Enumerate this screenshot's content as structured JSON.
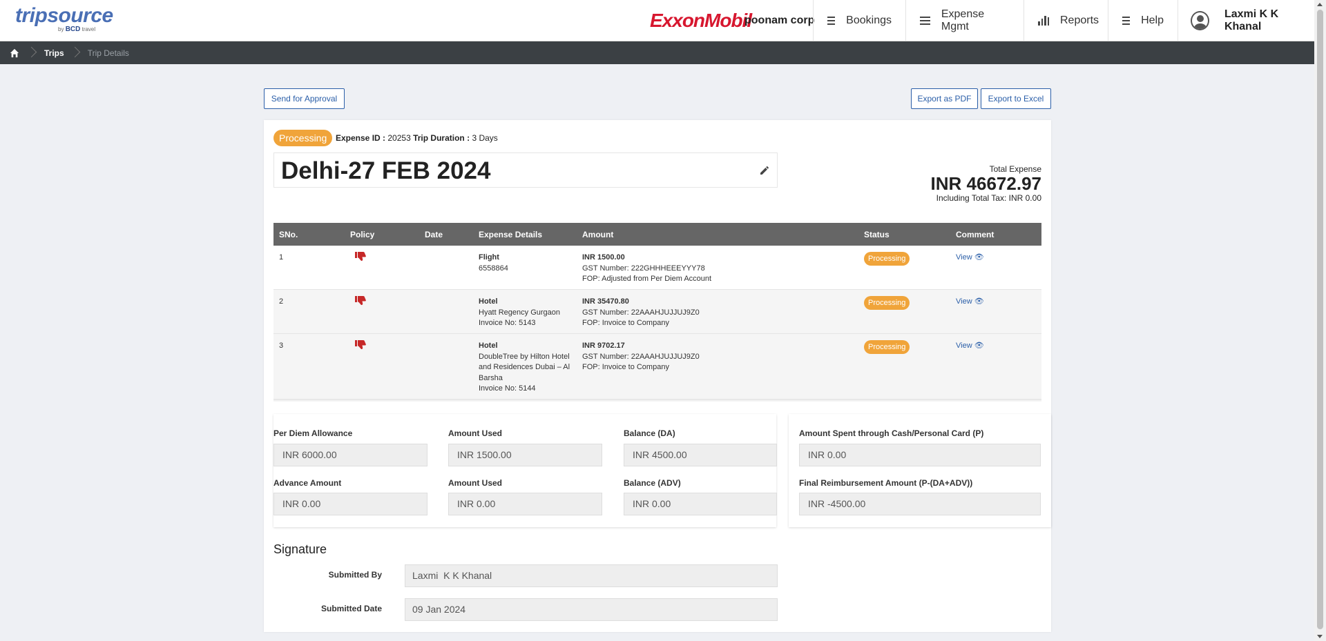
{
  "nav": {
    "logo_text": "tripsource",
    "logo_sub_by": "by",
    "logo_sub_bcd": "BCD",
    "logo_sub_travel": "travel",
    "brand": "ExxonMobil",
    "corp": "poonam corp",
    "items": [
      {
        "label": "Bookings",
        "icon": "menu-icon"
      },
      {
        "label": "Expense Mgmt",
        "icon": "menu-icon"
      },
      {
        "label": "Reports",
        "icon": "bar-chart-icon"
      },
      {
        "label": "Help",
        "icon": "menu-icon"
      }
    ],
    "user_name": "Laxmi K K Khanal"
  },
  "breadcrumb": {
    "trips": "Trips",
    "current": "Trip Details"
  },
  "actions": {
    "send_for_approval": "Send for Approval",
    "export_pdf": "Export as PDF",
    "export_excel": "Export to Excel"
  },
  "trip": {
    "status": "Processing",
    "expense_id_label": "Expense ID :",
    "expense_id": "20253",
    "duration_label": "Trip Duration :",
    "duration": "3 Days",
    "title": "Delhi-27 FEB 2024",
    "total_label": "Total Expense",
    "total_value": "INR 46672.97",
    "tax_line": "Including Total Tax: INR 0.00"
  },
  "table": {
    "headers": {
      "sno": "SNo.",
      "policy": "Policy",
      "date": "Date",
      "details": "Expense Details",
      "amount": "Amount",
      "status": "Status",
      "comment": "Comment"
    },
    "rows": [
      {
        "sno": "1",
        "date": "",
        "type": "Flight",
        "detail1": "6558864",
        "detail2": "",
        "detail3": "",
        "detail4": "",
        "amount": "INR 1500.00",
        "gst": "GST Number: 222GHHHEEEYYY78",
        "fop": "FOP: Adjusted from Per Diem Account",
        "status": "Processing",
        "comment": "View"
      },
      {
        "sno": "2",
        "date": "",
        "type": "Hotel",
        "detail1": "Hyatt Regency Gurgaon",
        "detail2": "Invoice No: 5143",
        "detail3": "",
        "detail4": "",
        "amount": "INR 35470.80",
        "gst": "GST Number: 22AAAHJUJJUJ9Z0",
        "fop": "FOP: Invoice to Company",
        "status": "Processing",
        "comment": "View"
      },
      {
        "sno": "3",
        "date": "",
        "type": "Hotel",
        "detail1": "DoubleTree by Hilton Hotel",
        "detail2": "and Residences Dubai – Al",
        "detail3": "Barsha",
        "detail4": "Invoice No: 5144",
        "amount": "INR 9702.17",
        "gst": "GST Number: 22AAAHJUJJUJ9Z0",
        "fop": "FOP: Invoice to Company",
        "status": "Processing",
        "comment": "View"
      }
    ]
  },
  "allowance": {
    "per_diem_label": "Per Diem Allowance",
    "per_diem_value": "INR 6000.00",
    "used1_label": "Amount Used",
    "used1_value": "INR 1500.00",
    "balance_da_label": "Balance (DA)",
    "balance_da_value": "INR 4500.00",
    "advance_label": "Advance Amount",
    "advance_value": "INR 0.00",
    "used2_label": "Amount Used",
    "used2_value": "INR 0.00",
    "balance_adv_label": "Balance (ADV)",
    "balance_adv_value": "INR 0.00",
    "cash_label": "Amount Spent through Cash/Personal Card (P)",
    "cash_value": "INR 0.00",
    "final_label": "Final Reimbursement Amount (P-(DA+ADV))",
    "final_value": "INR -4500.00"
  },
  "signature": {
    "title": "Signature",
    "submitted_by_label": "Submitted By",
    "submitted_by_value": "Laxmi  K K Khanal",
    "submitted_date_label": "Submitted Date",
    "submitted_date_value": "09 Jan 2024"
  },
  "colors": {
    "accent": "#2a5ea8",
    "status_processing": "#f0a43a",
    "policy_violation": "#c62828",
    "brand_red": "#d7172f"
  }
}
